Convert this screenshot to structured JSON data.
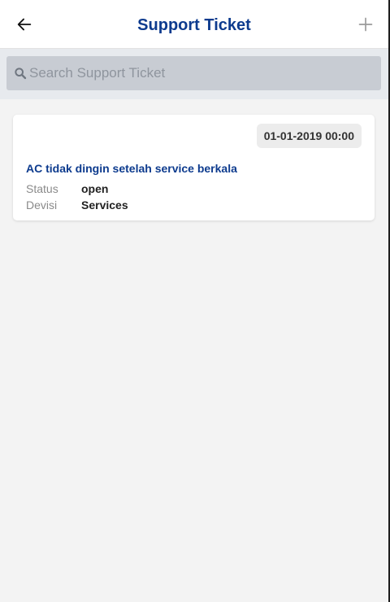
{
  "header": {
    "title": "Support Ticket",
    "back_icon": "arrow-left-icon",
    "add_icon": "plus-icon"
  },
  "search": {
    "placeholder": "Search Support Ticket",
    "value": "",
    "icon": "search-icon"
  },
  "tickets": [
    {
      "date": "01-01-2019 00:00",
      "title": "AC tidak dingin setelah service berkala",
      "status_label": "Status",
      "status_value": "open",
      "division_label": "Devisi",
      "division_value": "Services"
    }
  ],
  "colors": {
    "primary": "#0d3b8e",
    "background": "#f3f3f3",
    "search_bar": "#c8ccd3",
    "search_area": "#e7eaee",
    "badge": "#ececec"
  }
}
